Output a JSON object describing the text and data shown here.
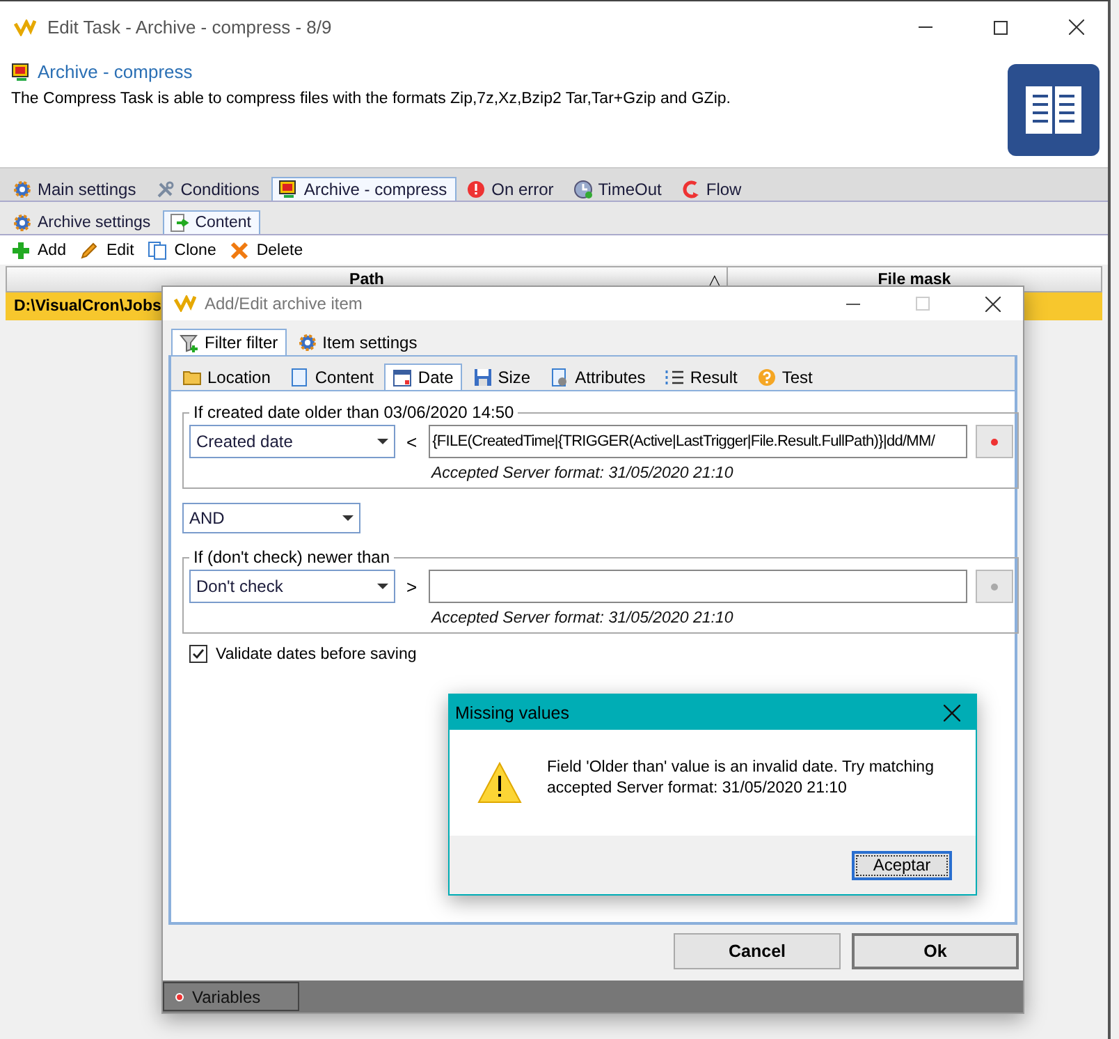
{
  "window": {
    "title": "Edit Task - Archive - compress - 8/9"
  },
  "header": {
    "title": "Archive - compress",
    "description": "The Compress Task is able to compress  files with the formats Zip,7z,Xz,Bzip2 Tar,Tar+Gzip and GZip."
  },
  "tabs": [
    {
      "label": "Main settings",
      "kind": "gear",
      "selected": false
    },
    {
      "label": "Conditions",
      "kind": "wrench",
      "selected": false
    },
    {
      "label": "Archive - compress",
      "kind": "monitor",
      "selected": true
    },
    {
      "label": "On error",
      "kind": "error",
      "selected": false
    },
    {
      "label": "TimeOut",
      "kind": "clock",
      "selected": false
    },
    {
      "label": "Flow",
      "kind": "flow",
      "selected": false
    }
  ],
  "subtabs": [
    {
      "label": "Archive settings",
      "kind": "gear",
      "selected": false
    },
    {
      "label": "Content",
      "kind": "content",
      "selected": true
    }
  ],
  "toolbar": [
    {
      "label": "Add",
      "kind": "plus"
    },
    {
      "label": "Edit",
      "kind": "pencil"
    },
    {
      "label": "Clone",
      "kind": "copy"
    },
    {
      "label": "Delete",
      "kind": "cross"
    }
  ],
  "table": {
    "columns": [
      {
        "label": "Path",
        "sort_indicator": "△"
      },
      {
        "label": "File mask"
      }
    ],
    "rows": [
      {
        "path": "D:\\VisualCron\\Jobs",
        "selected": true
      }
    ]
  },
  "dialog": {
    "title": "Add/Edit archive item",
    "tabs": [
      {
        "label": "Filter filter",
        "kind": "funnel",
        "selected": true
      },
      {
        "label": "Item settings",
        "kind": "gear",
        "selected": false
      }
    ],
    "subtabs": [
      {
        "label": "Location",
        "kind": "folder",
        "selected": false
      },
      {
        "label": "Content",
        "kind": "page",
        "selected": false
      },
      {
        "label": "Date",
        "kind": "calendar",
        "selected": true
      },
      {
        "label": "Size",
        "kind": "disk",
        "selected": false
      },
      {
        "label": "Attributes",
        "kind": "docgear",
        "selected": false
      },
      {
        "label": "Result",
        "kind": "list",
        "selected": false
      },
      {
        "label": "Test",
        "kind": "help",
        "selected": false
      }
    ],
    "groups": [
      {
        "legend": "If created date older than 03/06/2020 14:50",
        "select": "Created date",
        "operator": "<",
        "value": "{FILE(CreatedTime|{TRIGGER(Active|LastTrigger|File.Result.FullPath)}|dd/MM/",
        "hint": "Accepted Server format: 31/05/2020 21:10",
        "button_enabled": true
      },
      {
        "legend": "If (don't check) newer than",
        "select": "Don't check",
        "operator": ">",
        "hint": "Accepted Server format: 31/05/2020 21:10",
        "button_enabled": false
      }
    ],
    "join": "AND",
    "validate": {
      "label": "Validate dates before saving",
      "checked": true
    },
    "buttons": [
      {
        "label": "Cancel",
        "default": false
      },
      {
        "label": "Ok",
        "default": true
      }
    ],
    "variables_button": "Variables"
  },
  "message_box": {
    "title": "Missing values",
    "message": "Field 'Older than' value is an invalid date. Try matching accepted Server format: 31/05/2020 21:10",
    "button": "Aceptar"
  }
}
